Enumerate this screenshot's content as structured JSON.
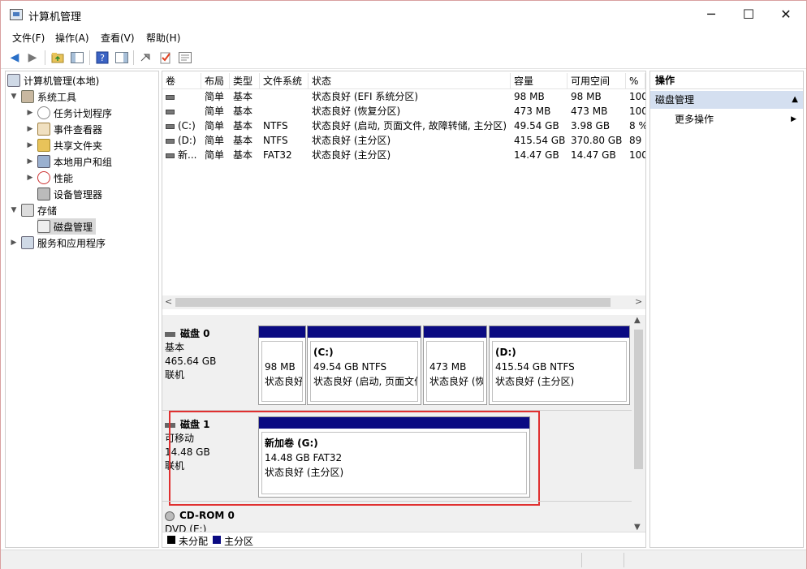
{
  "window": {
    "title": "计算机管理",
    "minimize_glyph": "─",
    "maximize_glyph": "☐",
    "close_glyph": "✕"
  },
  "menu": [
    "文件(F)",
    "操作(A)",
    "查看(V)",
    "帮助(H)"
  ],
  "toolbar": {
    "icons": [
      "back-arrow-icon",
      "forward-arrow-icon",
      "up-folder-icon",
      "show-hide-tree-icon",
      "help-icon",
      "show-hide-action-pane-icon",
      "connect-icon",
      "checklist-icon",
      "properties-icon"
    ]
  },
  "tree": {
    "root": "计算机管理(本地)",
    "system_tools": "系统工具",
    "items": [
      "任务计划程序",
      "事件查看器",
      "共享文件夹",
      "本地用户和组",
      "性能",
      "设备管理器"
    ],
    "storage": "存储",
    "disk_mgmt": "磁盘管理",
    "services": "服务和应用程序"
  },
  "volume_list": {
    "headers": [
      "卷",
      "布局",
      "类型",
      "文件系统",
      "状态",
      "容量",
      "可用空间",
      "%"
    ],
    "rows": [
      [
        "",
        "简单",
        "基本",
        "",
        "状态良好 (EFI 系统分区)",
        "98 MB",
        "98 MB",
        "100"
      ],
      [
        "",
        "简单",
        "基本",
        "",
        "状态良好 (恢复分区)",
        "473 MB",
        "473 MB",
        "100"
      ],
      [
        "(C:)",
        "简单",
        "基本",
        "NTFS",
        "状态良好 (启动, 页面文件, 故障转储, 主分区)",
        "49.54 GB",
        "3.98 GB",
        "8 %"
      ],
      [
        "(D:)",
        "简单",
        "基本",
        "NTFS",
        "状态良好 (主分区)",
        "415.54 GB",
        "370.80 GB",
        "89"
      ],
      [
        "新...",
        "简单",
        "基本",
        "FAT32",
        "状态良好 (主分区)",
        "14.47 GB",
        "14.47 GB",
        "100"
      ]
    ],
    "scroll_left": "<",
    "scroll_right": ">"
  },
  "disks": [
    {
      "name": "磁盘 0",
      "type": "基本",
      "size": "465.64 GB",
      "status": "联机",
      "partitions": [
        {
          "label": "",
          "size": "98 MB",
          "status": "状态良好"
        },
        {
          "label": "(C:)",
          "size": "49.54 GB NTFS",
          "status": "状态良好 (启动, 页面文件"
        },
        {
          "label": "",
          "size": "473 MB",
          "status": "状态良好 (恢"
        },
        {
          "label": "(D:)",
          "size": "415.54 GB NTFS",
          "status": "状态良好 (主分区)"
        }
      ]
    },
    {
      "name": "磁盘 1",
      "type": "可移动",
      "size": "14.48 GB",
      "status": "联机",
      "partitions": [
        {
          "label": "新加卷  (G:)",
          "size": "14.48 GB FAT32",
          "status": "状态良好 (主分区)"
        }
      ]
    },
    {
      "name": "CD-ROM 0",
      "type": "DVD (E:)"
    }
  ],
  "legend": {
    "unallocated": "未分配",
    "primary": "主分区"
  },
  "actions": {
    "title": "操作",
    "section": "磁盘管理",
    "more": "更多操作"
  },
  "colors": {
    "partition_bar": "#0a0a82",
    "highlight_box": "#e03030",
    "selection": "#d9d9d9",
    "action_header": "#d4dff0"
  }
}
